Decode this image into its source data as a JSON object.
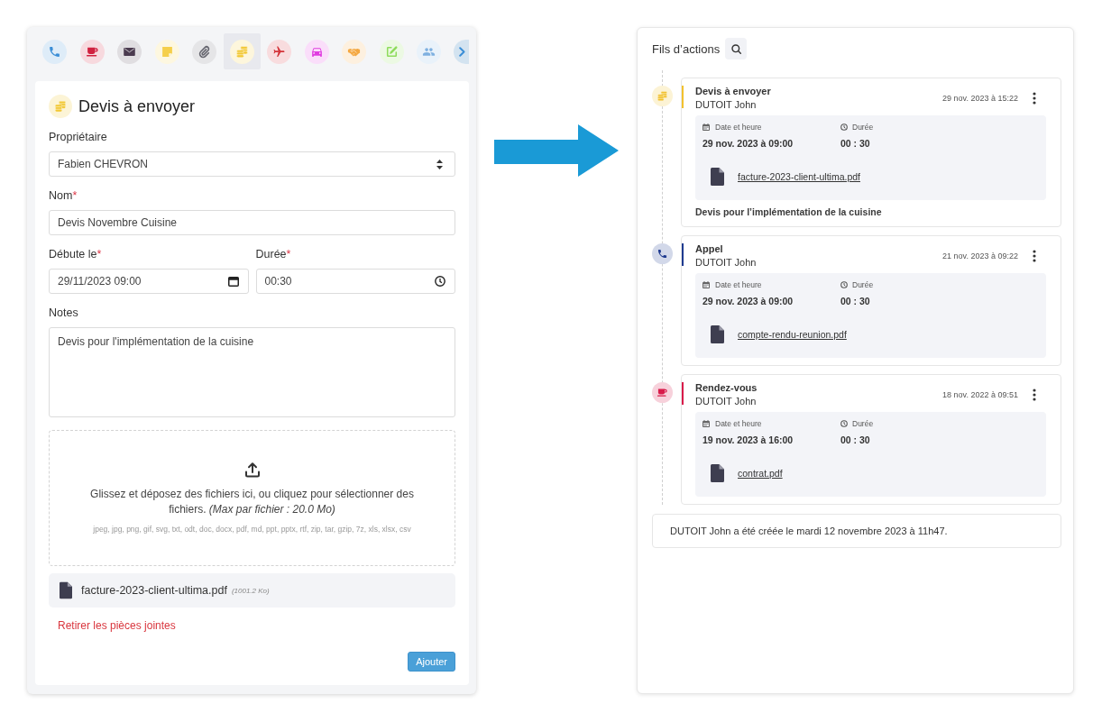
{
  "activity_editor": {
    "type_tabs": [
      {
        "kind": "phone",
        "color": "#3b8ed6",
        "selected": false
      },
      {
        "kind": "cup",
        "color": "#d0213f",
        "selected": false
      },
      {
        "kind": "envelope",
        "color": "#4b3b4f",
        "selected": false
      },
      {
        "kind": "note",
        "color": "#f5cf4a",
        "selected": false
      },
      {
        "kind": "paperclip",
        "color": "#676770",
        "selected": false
      },
      {
        "kind": "coins",
        "color": "#f2c834",
        "selected": true
      },
      {
        "kind": "plane",
        "color": "#d3343a",
        "selected": false
      },
      {
        "kind": "car",
        "color": "#e03ce0",
        "selected": false
      },
      {
        "kind": "handshake",
        "color": "#f4a842",
        "selected": false
      },
      {
        "kind": "edit",
        "color": "#8edc5c",
        "selected": false
      },
      {
        "kind": "users",
        "color": "#7eb0e0",
        "selected": false
      }
    ],
    "scroll_button": true,
    "title": {
      "kind": "coins",
      "color": "#f2c834",
      "text": "Devis à envoyer"
    },
    "owner": {
      "label": "Propriétaire",
      "value": "Fabien CHEVRON"
    },
    "name": {
      "label": "Nom",
      "required_mark": "*",
      "value": "Devis Novembre Cuisine"
    },
    "start": {
      "label": "Débute le",
      "required_mark": "*",
      "value": "29/11/2023 09:00"
    },
    "duration": {
      "label": "Durée",
      "required_mark": "*",
      "value": "00:30"
    },
    "notes": {
      "label": "Notes",
      "value": "Devis pour l'implémentation de la cuisine"
    },
    "dropzone": {
      "text": "Glissez et déposez des fichiers ici, ou cliquez pour sélectionner des fichiers. *(Max par fichier : 20.0 Mo)*",
      "formats": "jpeg, jpg, png, gif, svg, txt, odt, doc, docx, pdf, md, ppt, pptx, rtf, zip, tar, gzip, 7z, xls, xlsx, csv"
    },
    "attachments": [
      {
        "name": "facture-2023-client-ultima.pdf",
        "size": "(1001.2 Ko)"
      }
    ],
    "remove_link": "Retirer les pièces jointes",
    "submit": "Ajouter"
  },
  "action_feed": {
    "title": "Fils d’actions",
    "entries": [
      {
        "kind": "coins",
        "color": "#f2c12e",
        "title": "Devis à envoyer",
        "author": "DUTOIT John",
        "timestamp": "29 nov. 2023 à 15:22",
        "date_label": "Date et heure",
        "date": "29 nov. 2023 à 09:00",
        "duration_label": "Durée",
        "duration": "00 : 30",
        "attachment": "facture-2023-client-ultima.pdf",
        "note": "Devis pour l’implémentation de la cuisine"
      },
      {
        "kind": "phone",
        "color": "#1e3a8f",
        "title": "Appel",
        "author": "DUTOIT John",
        "timestamp": "21 nov. 2023 à 09:22",
        "date_label": "Date et heure",
        "date": "29 nov. 2023 à 09:00",
        "duration_label": "Durée",
        "duration": "00 : 30",
        "attachment": "compte-rendu-reunion.pdf"
      },
      {
        "kind": "cup",
        "color": "#d81b4a",
        "title": "Rendez-vous",
        "author": "DUTOIT John",
        "timestamp": "18 nov. 2022 à 09:51",
        "date_label": "Date et heure",
        "date": "19 nov. 2023 à 16:00",
        "duration_label": "Durée",
        "duration": "00 : 30",
        "attachment": "contrat.pdf"
      }
    ],
    "footer": "DUTOIT John a été créée le mardi 12 novembre 2023 à 11h47."
  }
}
